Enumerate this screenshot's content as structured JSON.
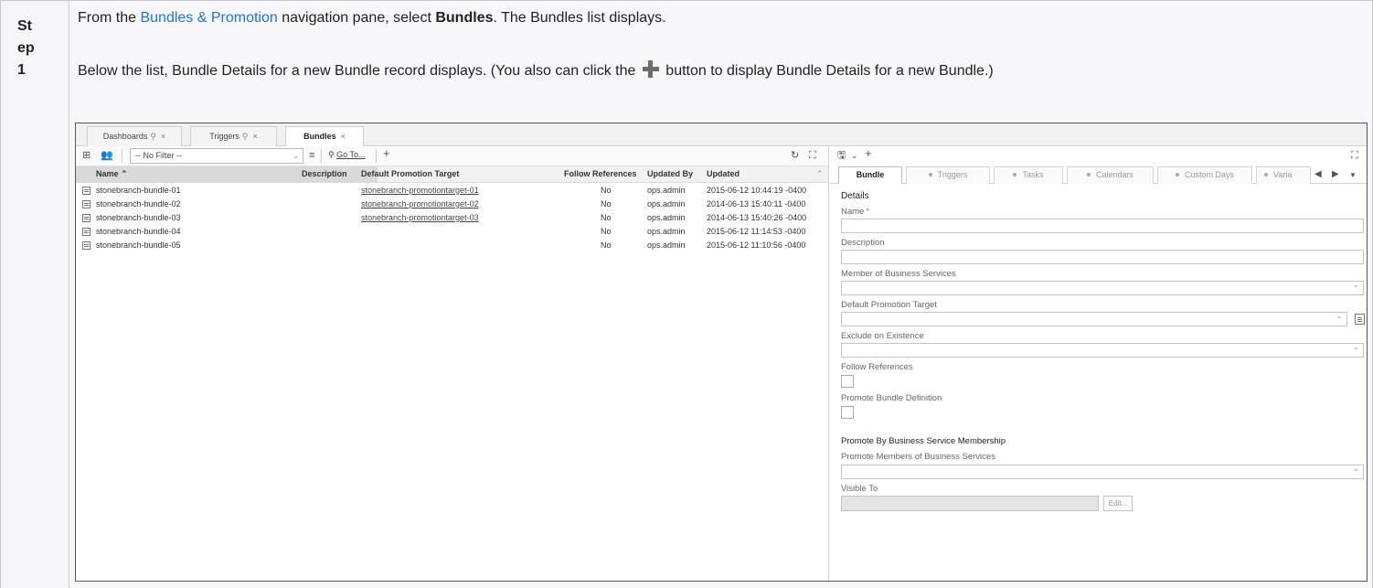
{
  "step": {
    "label": "St ep 1"
  },
  "instructions": {
    "para1_prefix": "From the ",
    "para1_link": "Bundles & Promotion",
    "para1_mid": " navigation pane, select ",
    "para1_bold": "Bundles",
    "para1_suffix": ". The Bundles list displays.",
    "para2_prefix": "Below the list, Bundle Details for a new Bundle record displays. (You also can click the ",
    "para2_suffix": " button to display Bundle Details for a new Bundle.)"
  },
  "app": {
    "tabs": [
      {
        "label": "Dashboards",
        "pinned": true
      },
      {
        "label": "Triggers",
        "pinned": true
      },
      {
        "label": "Bundles",
        "pinned": false,
        "active": true
      }
    ],
    "tab_close": "×",
    "pin_glyph": "⚲",
    "toolbar": {
      "filter_value": "-- No Filter --",
      "goto_label": "Go To...",
      "add_glyph": "+",
      "refresh_glyph": "↻",
      "expand_glyph": "⛶"
    },
    "columns": [
      "Name",
      "Description",
      "Default Promotion Target",
      "Follow References",
      "Updated By",
      "Updated"
    ],
    "sort_glyph": "⌃",
    "rows": [
      {
        "name": "stonebranch-bundle-01",
        "description": "",
        "target": "stonebranch-promotiontarget-01",
        "follow": "No",
        "updated_by": "ops.admin",
        "updated": "2015-06-12 10:44:19 -0400"
      },
      {
        "name": "stonebranch-bundle-02",
        "description": "",
        "target": "stonebranch-promotiontarget-02",
        "follow": "No",
        "updated_by": "ops.admin",
        "updated": "2014-06-13 15:40:11 -0400"
      },
      {
        "name": "stonebranch-bundle-03",
        "description": "",
        "target": "stonebranch-promotiontarget-03",
        "follow": "No",
        "updated_by": "ops.admin",
        "updated": "2014-06-13 15:40:26 -0400"
      },
      {
        "name": "stonebranch-bundle-04",
        "description": "",
        "target": "",
        "follow": "No",
        "updated_by": "ops.admin",
        "updated": "2015-06-12 11:14:53 -0400"
      },
      {
        "name": "stonebranch-bundle-05",
        "description": "",
        "target": "",
        "follow": "No",
        "updated_by": "ops.admin",
        "updated": "2015-06-12 11:10:56 -0400"
      }
    ],
    "details": {
      "save_glyph": "🖫",
      "dropdown_glyph": "⌄",
      "add_glyph": "+",
      "expand_glyph": "⛶",
      "tabs": [
        "Bundle",
        "Triggers",
        "Tasks",
        "Calendars",
        "Custom Days",
        "Varia"
      ],
      "nav_prev": "◀",
      "nav_next": "▶",
      "nav_menu": "▼",
      "section_details": "Details",
      "name_label": "Name",
      "required_mark": "*",
      "description_label": "Description",
      "member_label": "Member of Business Services",
      "target_label": "Default Promotion Target",
      "exclude_label": "Exclude on Existence",
      "follow_label": "Follow References",
      "promote_def_label": "Promote Bundle Definition",
      "section_membership": "Promote By Business Service Membership",
      "promote_members_label": "Promote Members of Business Services",
      "visible_to_label": "Visible To",
      "edit_button": "Edit..."
    }
  }
}
